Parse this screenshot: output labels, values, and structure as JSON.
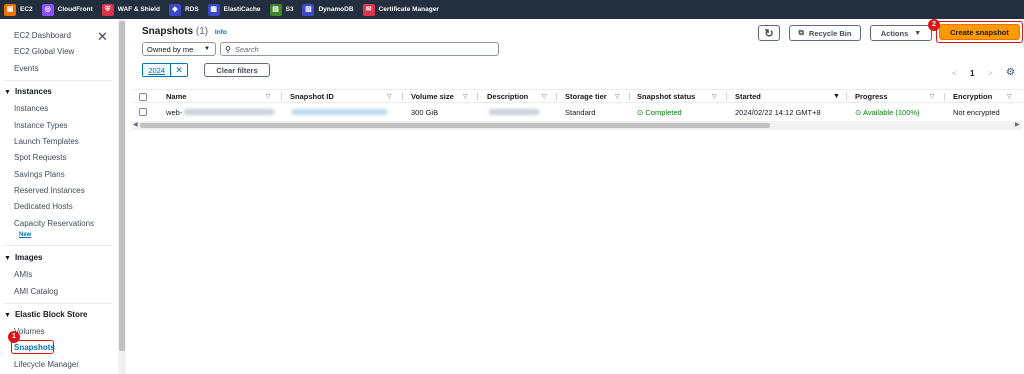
{
  "services": [
    {
      "label": "EC2",
      "icon": "ec2-icon",
      "color": "#ed7100"
    },
    {
      "label": "CloudFront",
      "icon": "cloudfront-icon",
      "color": "#8c4fff"
    },
    {
      "label": "WAF & Shield",
      "icon": "waf-shield-icon",
      "color": "#dd344c"
    },
    {
      "label": "RDS",
      "icon": "rds-icon",
      "color": "#3b48cc"
    },
    {
      "label": "ElastiCache",
      "icon": "elasticache-icon",
      "color": "#3b48cc"
    },
    {
      "label": "S3",
      "icon": "s3-icon",
      "color": "#3f8624"
    },
    {
      "label": "DynamoDB",
      "icon": "dynamodb-icon",
      "color": "#3b48cc"
    },
    {
      "label": "Certificate Manager",
      "icon": "certificate-manager-icon",
      "color": "#dd344c"
    }
  ],
  "sidebar": {
    "top_items": [
      "EC2 Dashboard",
      "EC2 Global View",
      "Events"
    ],
    "sections": {
      "instances": {
        "title": "Instances",
        "items": [
          "Instances",
          "Instance Types",
          "Launch Templates",
          "Spot Requests",
          "Savings Plans",
          "Reserved Instances",
          "Dedicated Hosts",
          "Capacity Reservations"
        ],
        "new_badge": "New"
      },
      "images": {
        "title": "Images",
        "items": [
          "AMIs",
          "AMI Catalog"
        ]
      },
      "ebs": {
        "title": "Elastic Block Store",
        "items": [
          "Volumes",
          "Snapshots",
          "Lifecycle Manager"
        ]
      }
    },
    "step_badge": "1"
  },
  "main": {
    "title": "Snapshots",
    "count": "(1)",
    "info_link": "Info",
    "refresh_icon": "refresh-icon",
    "recycle_bin_label": "Recycle Bin",
    "actions_label": "Actions",
    "create_label": "Create snapshot",
    "create_step_badge": "2",
    "owner_select": "Owned by me",
    "search_placeholder": "Search",
    "filter_token": "2024",
    "clear_filters_label": "Clear filters",
    "pager": {
      "prev": "<",
      "page": "1",
      "next": ">"
    }
  },
  "table": {
    "columns": [
      "Name",
      "Snapshot ID",
      "Volume size",
      "Description",
      "Storage tier",
      "Snapshot status",
      "Started",
      "Progress",
      "Encryption"
    ],
    "row": {
      "name": "web-",
      "volume_size": "300 GiB",
      "storage_tier": "Standard",
      "status": "Completed",
      "started": "2024/02/22 14:12 GMT+8",
      "progress": "Available (100%)",
      "encryption": "Not encrypted"
    }
  }
}
